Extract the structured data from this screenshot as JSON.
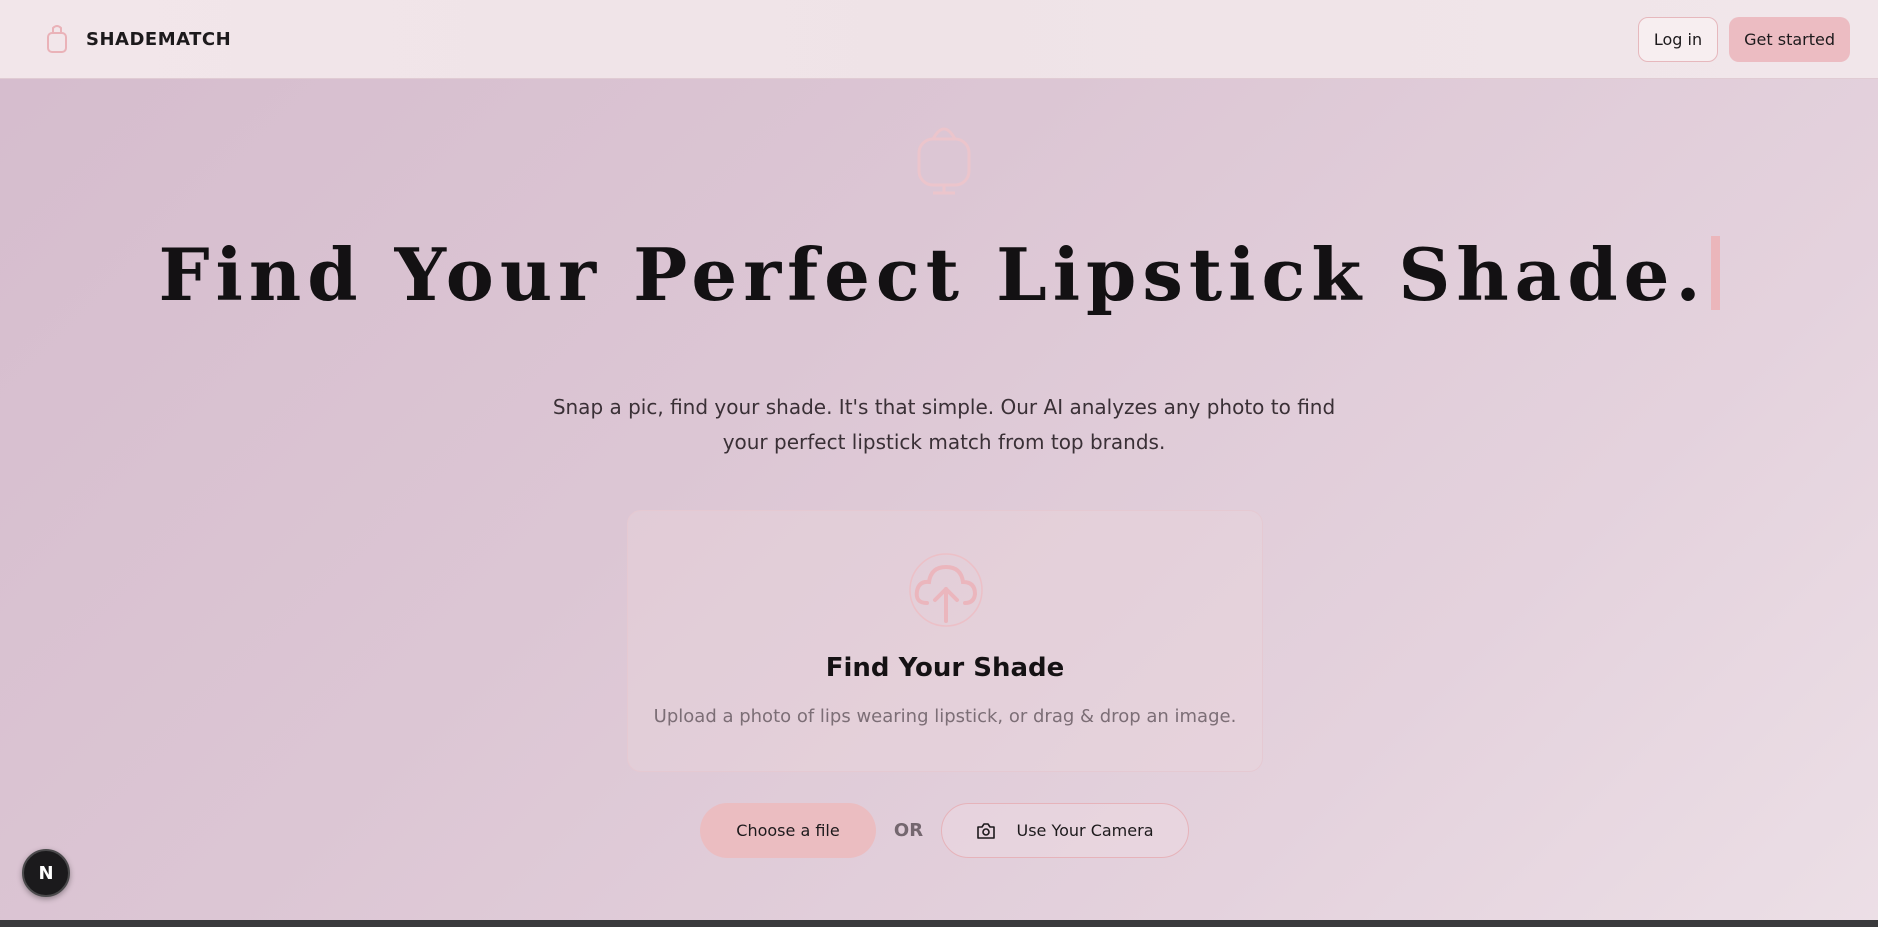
{
  "brand": {
    "name": "SHADEMATCH",
    "icon": "lipstick-icon"
  },
  "nav": {
    "login_label": "Log in",
    "get_started_label": "Get started"
  },
  "hero": {
    "icon": "lipstick-icon",
    "headline": "Find Your Perfect Lipstick Shade.",
    "subtitle": "Snap a pic, find your shade. It's that simple. Our AI analyzes any photo to find your perfect lipstick match from top brands."
  },
  "upload": {
    "icon": "cloud-upload-icon",
    "title": "Find Your Shade",
    "description": "Upload a photo of lips wearing lipstick, or drag & drop an image."
  },
  "actions": {
    "choose_file_label": "Choose a file",
    "or_label": "OR",
    "camera_label": "Use Your Camera",
    "camera_icon": "camera-icon"
  },
  "devtools": {
    "badge_letter": "N"
  },
  "colors": {
    "accent": "#ebbdc1",
    "accent_border": "#e6b3ba",
    "background": "#dcc6d4",
    "navbar": "#f1e6ea",
    "text": "#141214"
  }
}
